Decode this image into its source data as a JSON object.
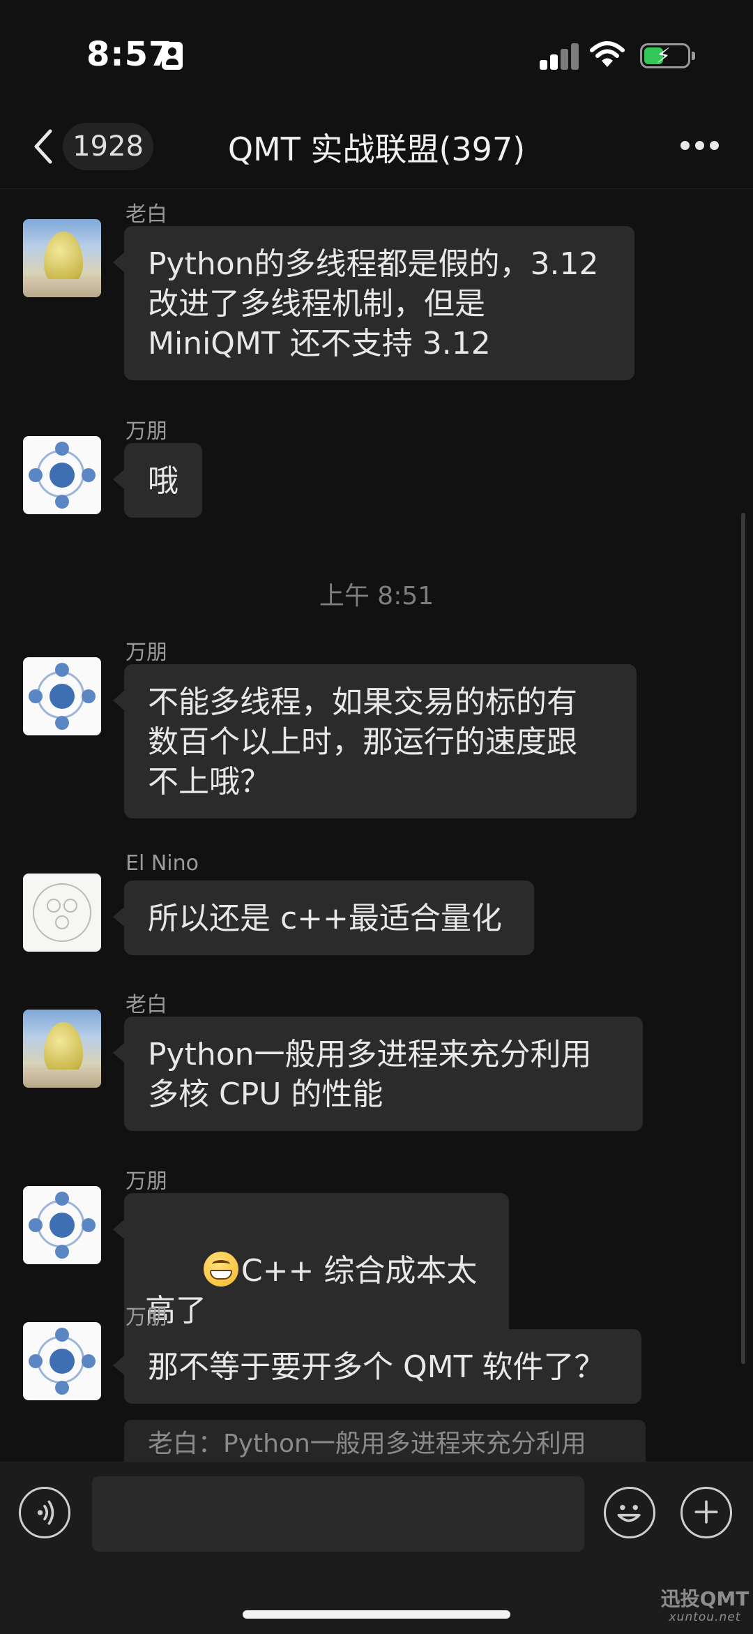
{
  "status_bar": {
    "time": "8:57",
    "battery_charge": 0.48,
    "charging": true
  },
  "nav": {
    "back_count": "1928",
    "title": "QMT 实战联盟(397)"
  },
  "messages": [
    {
      "sender": "老白",
      "avatar": "fruit-photo-avatar",
      "text": "Python的多线程都是假的，3.12\n改进了多线程机制，但是\nMiniQMT 还不支持 3.12"
    },
    {
      "sender": "万朋",
      "avatar": "diagram-avatar",
      "text": "哦"
    },
    {
      "sender": "万朋",
      "avatar": "diagram-avatar",
      "text": "不能多线程，如果交易的标的有\n数百个以上时，那运行的速度跟\n不上哦？"
    },
    {
      "sender": "El Nino",
      "avatar": "face-outline-avatar",
      "text": "所以还是 c++最适合量化"
    },
    {
      "sender": "老白",
      "avatar": "fruit-photo-avatar",
      "text": "Python一般用多进程来充分利用\n多核 CPU 的性能"
    },
    {
      "sender": "万朋",
      "avatar": "diagram-avatar",
      "emoji": "grinning-face",
      "text": "C++ 综合成本太高了"
    },
    {
      "sender": "万朋",
      "avatar": "diagram-avatar",
      "text": "那不等于要开多个 QMT 软件了？"
    }
  ],
  "timestamp": "上午 8:51",
  "quote_preview": "老白：Python一般用多进程来充分利用",
  "input_bar": {
    "message_placeholder": ""
  },
  "watermark": {
    "line1": "迅投QMT",
    "line2": "xuntou.net"
  }
}
